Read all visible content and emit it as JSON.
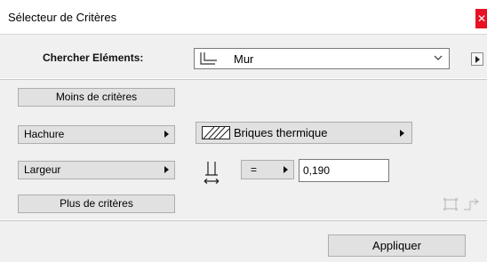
{
  "window": {
    "title": "Sélecteur de Critères",
    "close_glyph": "✕"
  },
  "find": {
    "label": "Chercher Eléments:",
    "selected_value": "Mur",
    "icon": "wall-icon"
  },
  "criteria": {
    "less_label": "Moins de critères",
    "more_label": "Plus de critères",
    "hatch": {
      "label": "Hachure",
      "value": "Briques thermique"
    },
    "width": {
      "label": "Largeur",
      "operator": "=",
      "value": "0,190"
    }
  },
  "footer": {
    "apply_label": "Appliquer"
  }
}
